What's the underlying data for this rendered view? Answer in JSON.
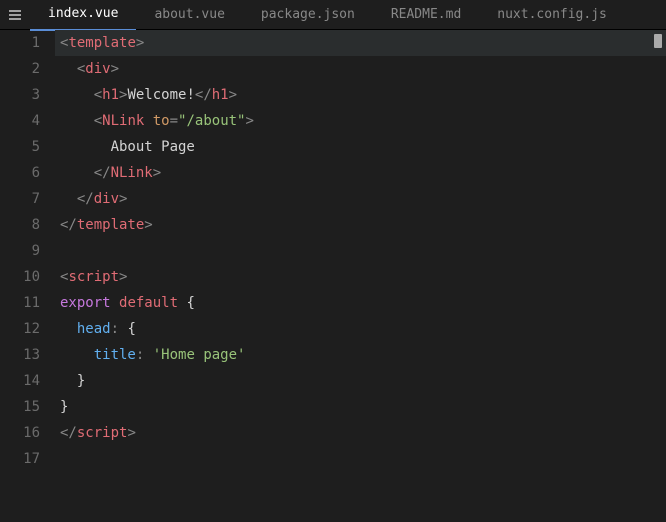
{
  "tabs": {
    "items": [
      {
        "label": "index.vue",
        "active": true
      },
      {
        "label": "about.vue",
        "active": false
      },
      {
        "label": "package.json",
        "active": false
      },
      {
        "label": "README.md",
        "active": false
      },
      {
        "label": "nuxt.config.js",
        "active": false
      }
    ]
  },
  "lines": {
    "n1": "1",
    "n2": "2",
    "n3": "3",
    "n4": "4",
    "n5": "5",
    "n6": "6",
    "n7": "7",
    "n8": "8",
    "n9": "9",
    "n10": "10",
    "n11": "11",
    "n12": "12",
    "n13": "13",
    "n14": "14",
    "n15": "15",
    "n16": "16",
    "n17": "17"
  },
  "tok": {
    "lt": "<",
    "gt": ">",
    "lts": "</",
    "sp1": "  ",
    "sp2": "    ",
    "sp3": "      ",
    "template": "template",
    "div": "div",
    "h1": "h1",
    "nlink": "NLink",
    "script": "script",
    "welcome": "Welcome!",
    "to": "to",
    "eq": "=",
    "about": "\"/about\"",
    "aboutpage": "About Page",
    "export": "export",
    "default": "default",
    "brace_o": " {",
    "brace_c": "}",
    "head": "head",
    "colon": ":",
    "brace_o2": " {",
    "title": "title",
    "homepage": "'Home page'",
    "brace_c2": "  }"
  }
}
